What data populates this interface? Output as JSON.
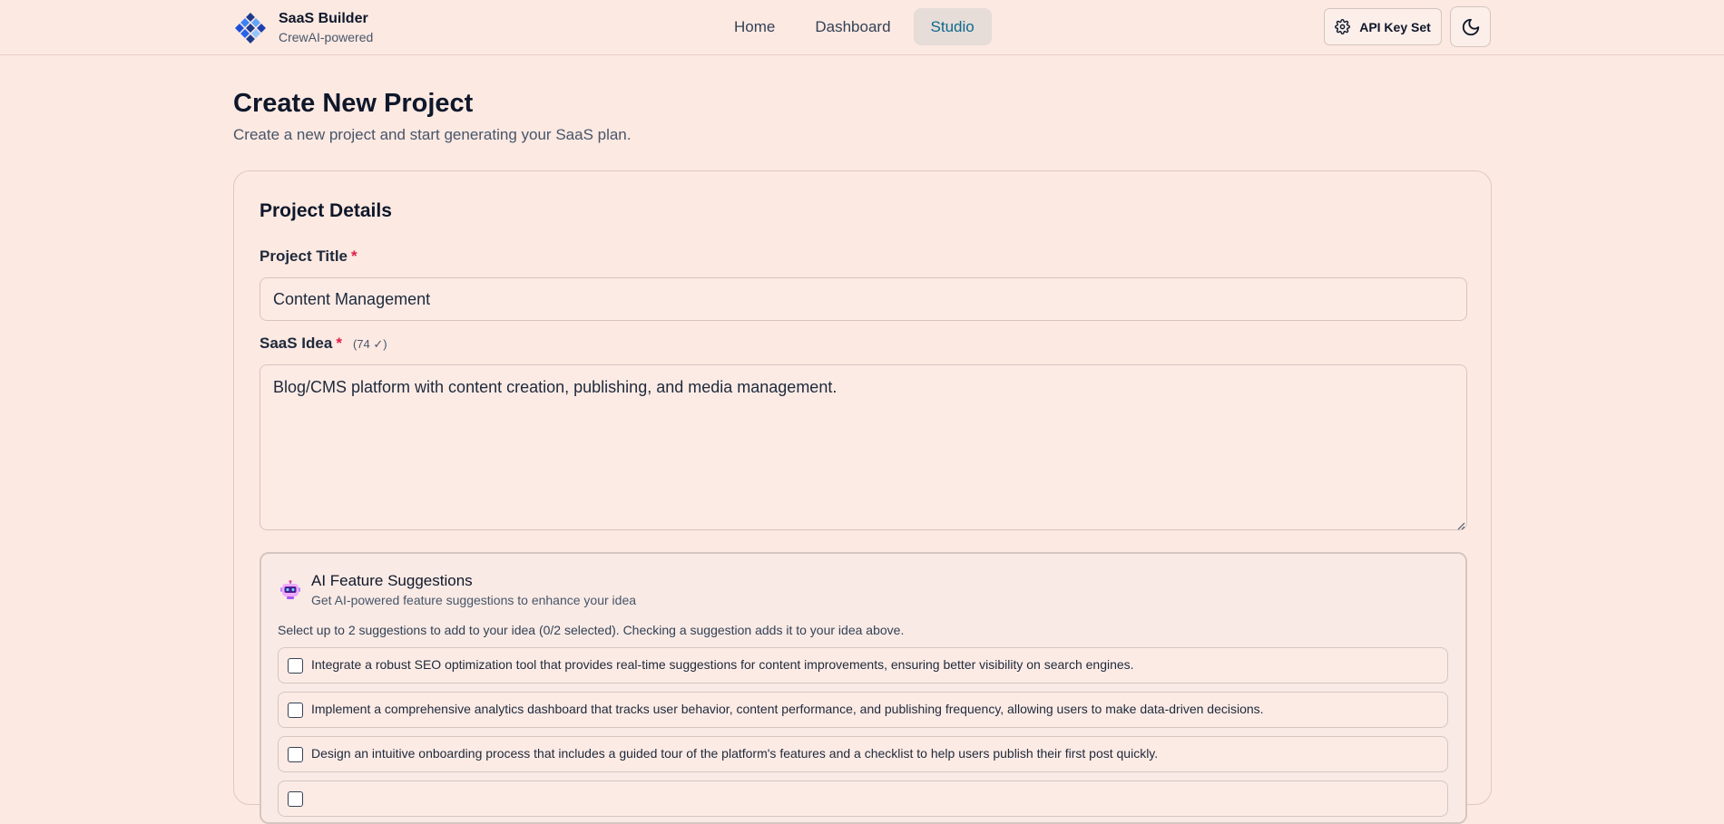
{
  "header": {
    "brand_title": "SaaS Builder",
    "brand_subtitle": "CrewAI-powered",
    "nav": [
      {
        "label": "Home",
        "active": false
      },
      {
        "label": "Dashboard",
        "active": false
      },
      {
        "label": "Studio",
        "active": true
      }
    ],
    "api_button_label": "API Key Set",
    "icons": {
      "logo": "diamond-grid-logo-icon",
      "api": "gear-icon",
      "theme": "moon-icon"
    }
  },
  "page": {
    "title": "Create New Project",
    "subtitle": "Create a new project and start generating your SaaS plan."
  },
  "form": {
    "card_title": "Project Details",
    "project_title_label": "Project Title",
    "required_mark": "*",
    "project_title_value": "Content Management",
    "idea_label": "SaaS Idea",
    "idea_count": "(74 ✓)",
    "idea_value": "Blog/CMS platform with content creation, publishing, and media management."
  },
  "ai": {
    "icon": "robot-icon",
    "title": "AI Feature Suggestions",
    "subtitle": "Get AI-powered feature suggestions to enhance your idea",
    "instructions": "Select up to 2 suggestions to add to your idea (0/2 selected). Checking a suggestion adds it to your idea above.",
    "suggestions": [
      {
        "text": "Integrate a robust SEO optimization tool that provides real-time suggestions for content improvements, ensuring better visibility on search engines.",
        "checked": false
      },
      {
        "text": "Implement a comprehensive analytics dashboard that tracks user behavior, content performance, and publishing frequency, allowing users to make data-driven decisions.",
        "checked": false
      },
      {
        "text": "Design an intuitive onboarding process that includes a guided tour of the platform's features and a checklist to help users publish their first post quickly.",
        "checked": false
      }
    ]
  },
  "colors": {
    "background": "#fce9e2",
    "accent": "#0e6a8c",
    "required": "#e11d48",
    "text": "#0f172a"
  }
}
